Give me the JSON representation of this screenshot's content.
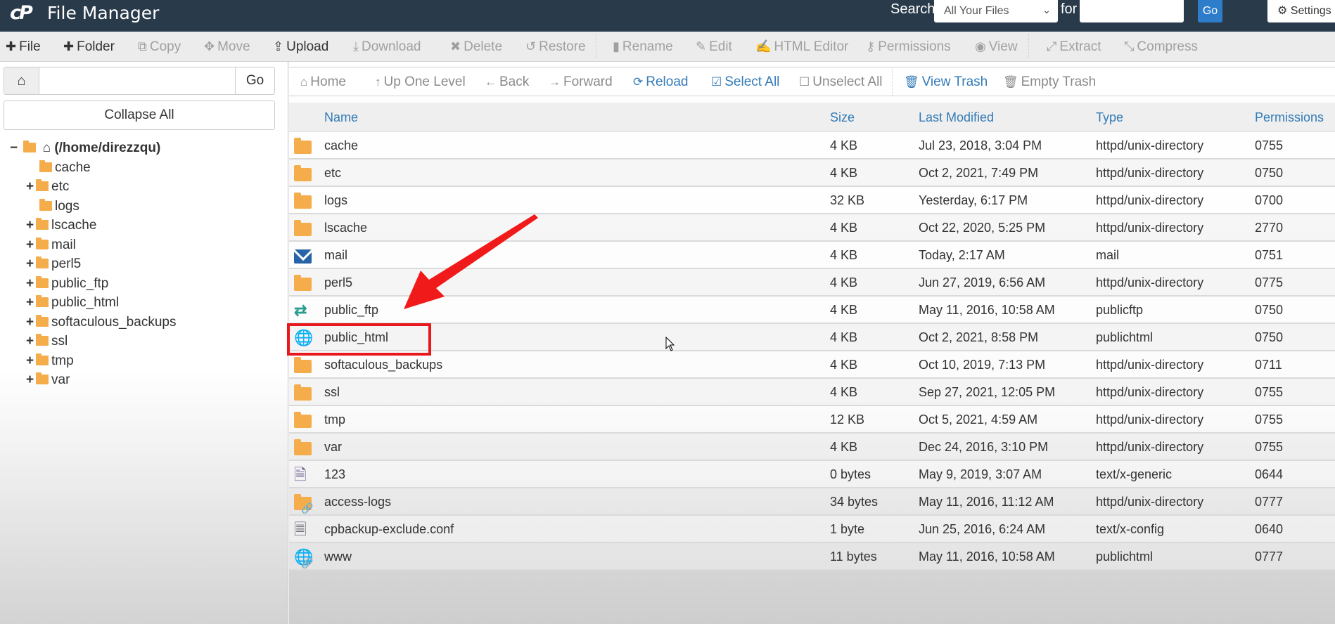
{
  "header": {
    "logo": "cP",
    "title": "File Manager",
    "search_label": "Search",
    "search_scope": "All Your Files",
    "for_label": "for",
    "search_query": "",
    "go_label": "Go",
    "settings_label": "Settings"
  },
  "toolbar": [
    {
      "label": "File",
      "icon": "plus-icon",
      "glyph": "✚",
      "enabled": true
    },
    {
      "label": "Folder",
      "icon": "plus-icon",
      "glyph": "✚",
      "enabled": true
    },
    {
      "label": "Copy",
      "icon": "copy-icon",
      "glyph": "⧉",
      "enabled": false
    },
    {
      "label": "Move",
      "icon": "move-icon",
      "glyph": "✥",
      "enabled": false
    },
    {
      "label": "Upload",
      "icon": "upload-icon",
      "glyph": "⇪",
      "enabled": true
    },
    {
      "label": "Download",
      "icon": "download-icon",
      "glyph": "⤓",
      "enabled": false
    },
    {
      "label": "Delete",
      "icon": "delete-icon",
      "glyph": "✖",
      "enabled": false
    },
    {
      "label": "Restore",
      "icon": "restore-icon",
      "glyph": "↺",
      "enabled": false
    },
    {
      "label": "Rename",
      "icon": "rename-icon",
      "glyph": "▮",
      "enabled": false
    },
    {
      "label": "Edit",
      "icon": "pencil-icon",
      "glyph": "✎",
      "enabled": false
    },
    {
      "label": "HTML Editor",
      "icon": "html-editor-icon",
      "glyph": "✍",
      "enabled": false
    },
    {
      "label": "Permissions",
      "icon": "key-icon",
      "glyph": "⚷",
      "enabled": false
    },
    {
      "label": "View",
      "icon": "eye-icon",
      "glyph": "◉",
      "enabled": false
    },
    {
      "label": "Extract",
      "icon": "extract-icon",
      "glyph": "⤢",
      "enabled": false
    },
    {
      "label": "Compress",
      "icon": "compress-icon",
      "glyph": "⤡",
      "enabled": false
    }
  ],
  "sidebar": {
    "path_value": "",
    "go_label": "Go",
    "collapse_label": "Collapse All",
    "root_label": "(/home/direzzqu)",
    "tree": [
      {
        "label": "cache",
        "expandable": false
      },
      {
        "label": "etc",
        "expandable": true
      },
      {
        "label": "logs",
        "expandable": false
      },
      {
        "label": "lscache",
        "expandable": true
      },
      {
        "label": "mail",
        "expandable": true
      },
      {
        "label": "perl5",
        "expandable": true
      },
      {
        "label": "public_ftp",
        "expandable": true
      },
      {
        "label": "public_html",
        "expandable": true
      },
      {
        "label": "softaculous_backups",
        "expandable": true
      },
      {
        "label": "ssl",
        "expandable": true
      },
      {
        "label": "tmp",
        "expandable": true
      },
      {
        "label": "var",
        "expandable": true
      }
    ]
  },
  "navbar": [
    {
      "label": "Home",
      "icon": "home-icon",
      "glyph": "⌂",
      "color": "gray"
    },
    {
      "label": "Up One Level",
      "icon": "up-arrow-icon",
      "glyph": "↑",
      "color": "gray"
    },
    {
      "label": "Back",
      "icon": "back-arrow-icon",
      "glyph": "←",
      "color": "gray"
    },
    {
      "label": "Forward",
      "icon": "forward-arrow-icon",
      "glyph": "→",
      "color": "gray"
    },
    {
      "label": "Reload",
      "icon": "reload-icon",
      "glyph": "⟳",
      "color": "blue"
    },
    {
      "label": "Select All",
      "icon": "checked-box-icon",
      "glyph": "☑",
      "color": "blue"
    },
    {
      "label": "Unselect All",
      "icon": "empty-box-icon",
      "glyph": "☐",
      "color": "gray"
    },
    {
      "label": "View Trash",
      "icon": "trash-icon",
      "glyph": "🗑",
      "color": "blue"
    },
    {
      "label": "Empty Trash",
      "icon": "trash-icon",
      "glyph": "🗑",
      "color": "gray"
    }
  ],
  "table": {
    "columns": [
      "Name",
      "Size",
      "Last Modified",
      "Type",
      "Permissions"
    ],
    "rows": [
      {
        "icon": "folder",
        "name": "cache",
        "size": "4 KB",
        "modified": "Jul 23, 2018, 3:04 PM",
        "type": "httpd/unix-directory",
        "perms": "0755"
      },
      {
        "icon": "folder",
        "name": "etc",
        "size": "4 KB",
        "modified": "Oct 2, 2021, 7:49 PM",
        "type": "httpd/unix-directory",
        "perms": "0750"
      },
      {
        "icon": "folder",
        "name": "logs",
        "size": "32 KB",
        "modified": "Yesterday, 6:17 PM",
        "type": "httpd/unix-directory",
        "perms": "0700"
      },
      {
        "icon": "folder",
        "name": "lscache",
        "size": "4 KB",
        "modified": "Oct 22, 2020, 5:25 PM",
        "type": "httpd/unix-directory",
        "perms": "2770"
      },
      {
        "icon": "mail",
        "name": "mail",
        "size": "4 KB",
        "modified": "Today, 2:17 AM",
        "type": "mail",
        "perms": "0751"
      },
      {
        "icon": "folder",
        "name": "perl5",
        "size": "4 KB",
        "modified": "Jun 27, 2019, 6:56 AM",
        "type": "httpd/unix-directory",
        "perms": "0775"
      },
      {
        "icon": "publicftp",
        "name": "public_ftp",
        "size": "4 KB",
        "modified": "May 11, 2016, 10:58 AM",
        "type": "publicftp",
        "perms": "0750"
      },
      {
        "icon": "globe",
        "name": "public_html",
        "size": "4 KB",
        "modified": "Oct 2, 2021, 8:58 PM",
        "type": "publichtml",
        "perms": "0750"
      },
      {
        "icon": "folder",
        "name": "softaculous_backups",
        "size": "4 KB",
        "modified": "Oct 10, 2019, 7:13 PM",
        "type": "httpd/unix-directory",
        "perms": "0711"
      },
      {
        "icon": "folder",
        "name": "ssl",
        "size": "4 KB",
        "modified": "Sep 27, 2021, 12:05 PM",
        "type": "httpd/unix-directory",
        "perms": "0755"
      },
      {
        "icon": "folder",
        "name": "tmp",
        "size": "12 KB",
        "modified": "Oct 5, 2021, 4:59 AM",
        "type": "httpd/unix-directory",
        "perms": "0755"
      },
      {
        "icon": "folder",
        "name": "var",
        "size": "4 KB",
        "modified": "Dec 24, 2016, 3:10 PM",
        "type": "httpd/unix-directory",
        "perms": "0755"
      },
      {
        "icon": "file",
        "name": "123",
        "size": "0 bytes",
        "modified": "May 9, 2019, 3:07 AM",
        "type": "text/x-generic",
        "perms": "0644"
      },
      {
        "icon": "folder-link",
        "name": "access-logs",
        "size": "34 bytes",
        "modified": "May 11, 2016, 11:12 AM",
        "type": "httpd/unix-directory",
        "perms": "0777"
      },
      {
        "icon": "config",
        "name": "cpbackup-exclude.conf",
        "size": "1 byte",
        "modified": "Jun 25, 2016, 6:24 AM",
        "type": "text/x-config",
        "perms": "0640"
      },
      {
        "icon": "globe-link",
        "name": "www",
        "size": "11 bytes",
        "modified": "May 11, 2016, 10:58 AM",
        "type": "publichtml",
        "perms": "0777"
      }
    ]
  },
  "annotation": {
    "highlighted_item": "public_html",
    "color": "#e8171b"
  },
  "colors": {
    "header_bg": "#293a4a",
    "accent_blue": "#337ab7",
    "folder": "#f5ad4c"
  }
}
